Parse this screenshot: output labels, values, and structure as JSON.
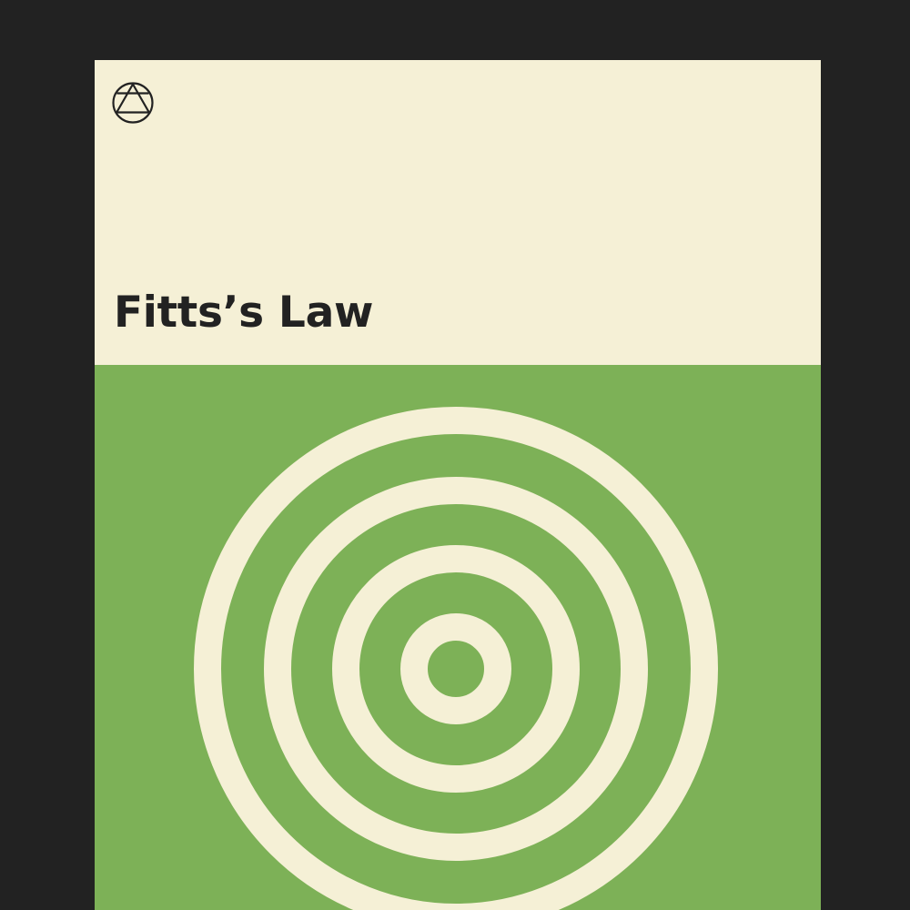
{
  "card": {
    "title": "Fitts’s Law",
    "logo_icon": "circle-triangle-emblem-icon",
    "illustration_icon": "concentric-target-rings-icon"
  },
  "colors": {
    "background": "#222222",
    "cream": "#f5f0d6",
    "green": "#7db157",
    "ink": "#222222"
  }
}
